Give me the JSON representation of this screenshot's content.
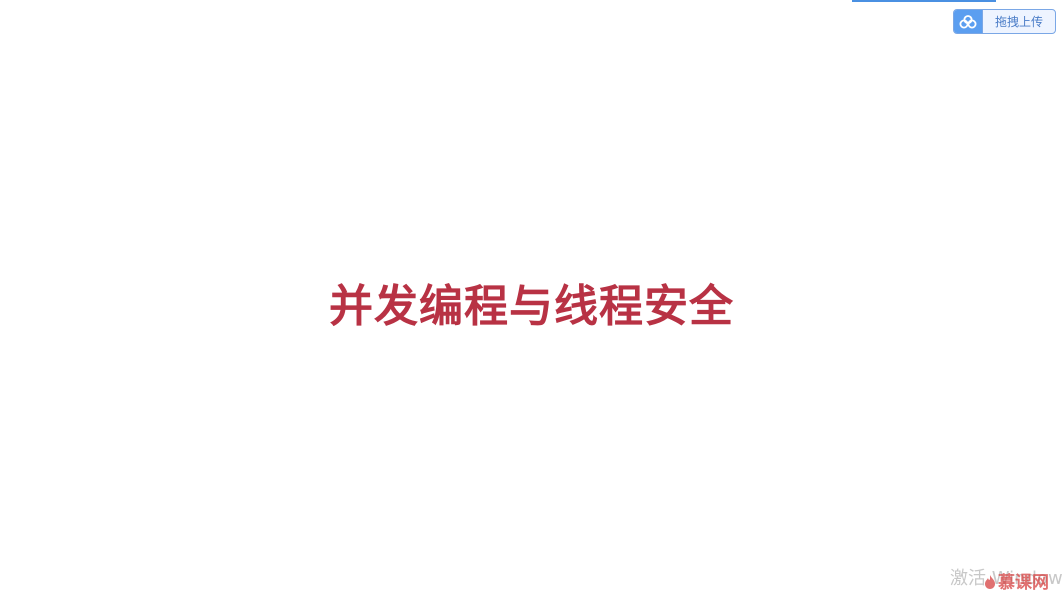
{
  "upload": {
    "label": "拖拽上传",
    "icon": "cloud-icon"
  },
  "slide": {
    "title": "并发编程与线程安全"
  },
  "watermark": {
    "activate_text": "激活 Windows",
    "brand_text": "慕课网",
    "brand_icon": "flame-icon"
  },
  "colors": {
    "title": "#b83244",
    "upload_accent": "#5b9ef0",
    "progress": "#4a90e2"
  }
}
